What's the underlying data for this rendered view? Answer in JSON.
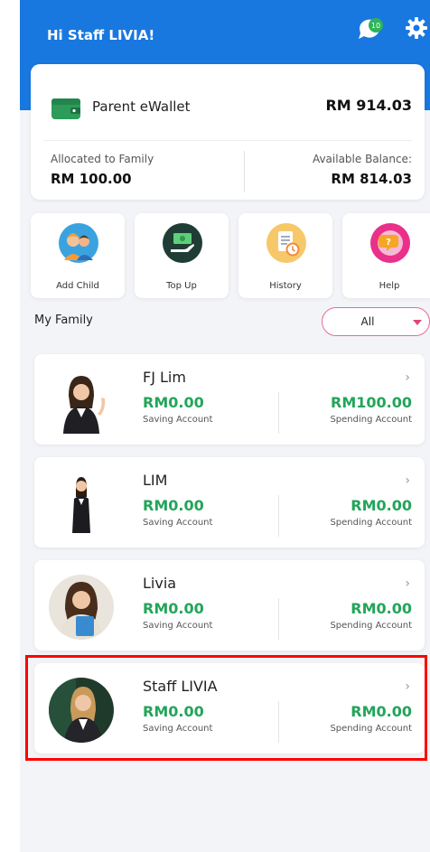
{
  "header": {
    "greeting": "Hi Staff LIVIA!",
    "notification_count": "10"
  },
  "wallet": {
    "label": "Parent eWallet",
    "amount": "RM 914.03",
    "allocated_label": "Allocated to Family",
    "allocated_value": "RM 100.00",
    "available_label": "Available Balance:",
    "available_value": "RM 814.03"
  },
  "actions": [
    {
      "label": "Add Child",
      "icon": "add-child-icon"
    },
    {
      "label": "Top Up",
      "icon": "top-up-icon"
    },
    {
      "label": "History",
      "icon": "history-icon"
    },
    {
      "label": "Help",
      "icon": "help-icon"
    }
  ],
  "family": {
    "title": "My Family",
    "filter": "All",
    "members": [
      {
        "name": "FJ Lim",
        "saving": "RM0.00",
        "saving_label": "Saving Account",
        "spending": "RM100.00",
        "spending_label": "Spending Account"
      },
      {
        "name": "LIM",
        "saving": "RM0.00",
        "saving_label": "Saving Account",
        "spending": "RM0.00",
        "spending_label": "Spending Account"
      },
      {
        "name": "Livia",
        "saving": "RM0.00",
        "saving_label": "Saving Account",
        "spending": "RM0.00",
        "spending_label": "Spending Account"
      },
      {
        "name": "Staff LIVIA",
        "saving": "RM0.00",
        "saving_label": "Saving Account",
        "spending": "RM0.00",
        "spending_label": "Spending Account"
      }
    ]
  },
  "colors": {
    "header": "#1878df",
    "amount_green": "#22a55a",
    "highlight": "#ff0000",
    "filter_accent": "#e0457b"
  }
}
